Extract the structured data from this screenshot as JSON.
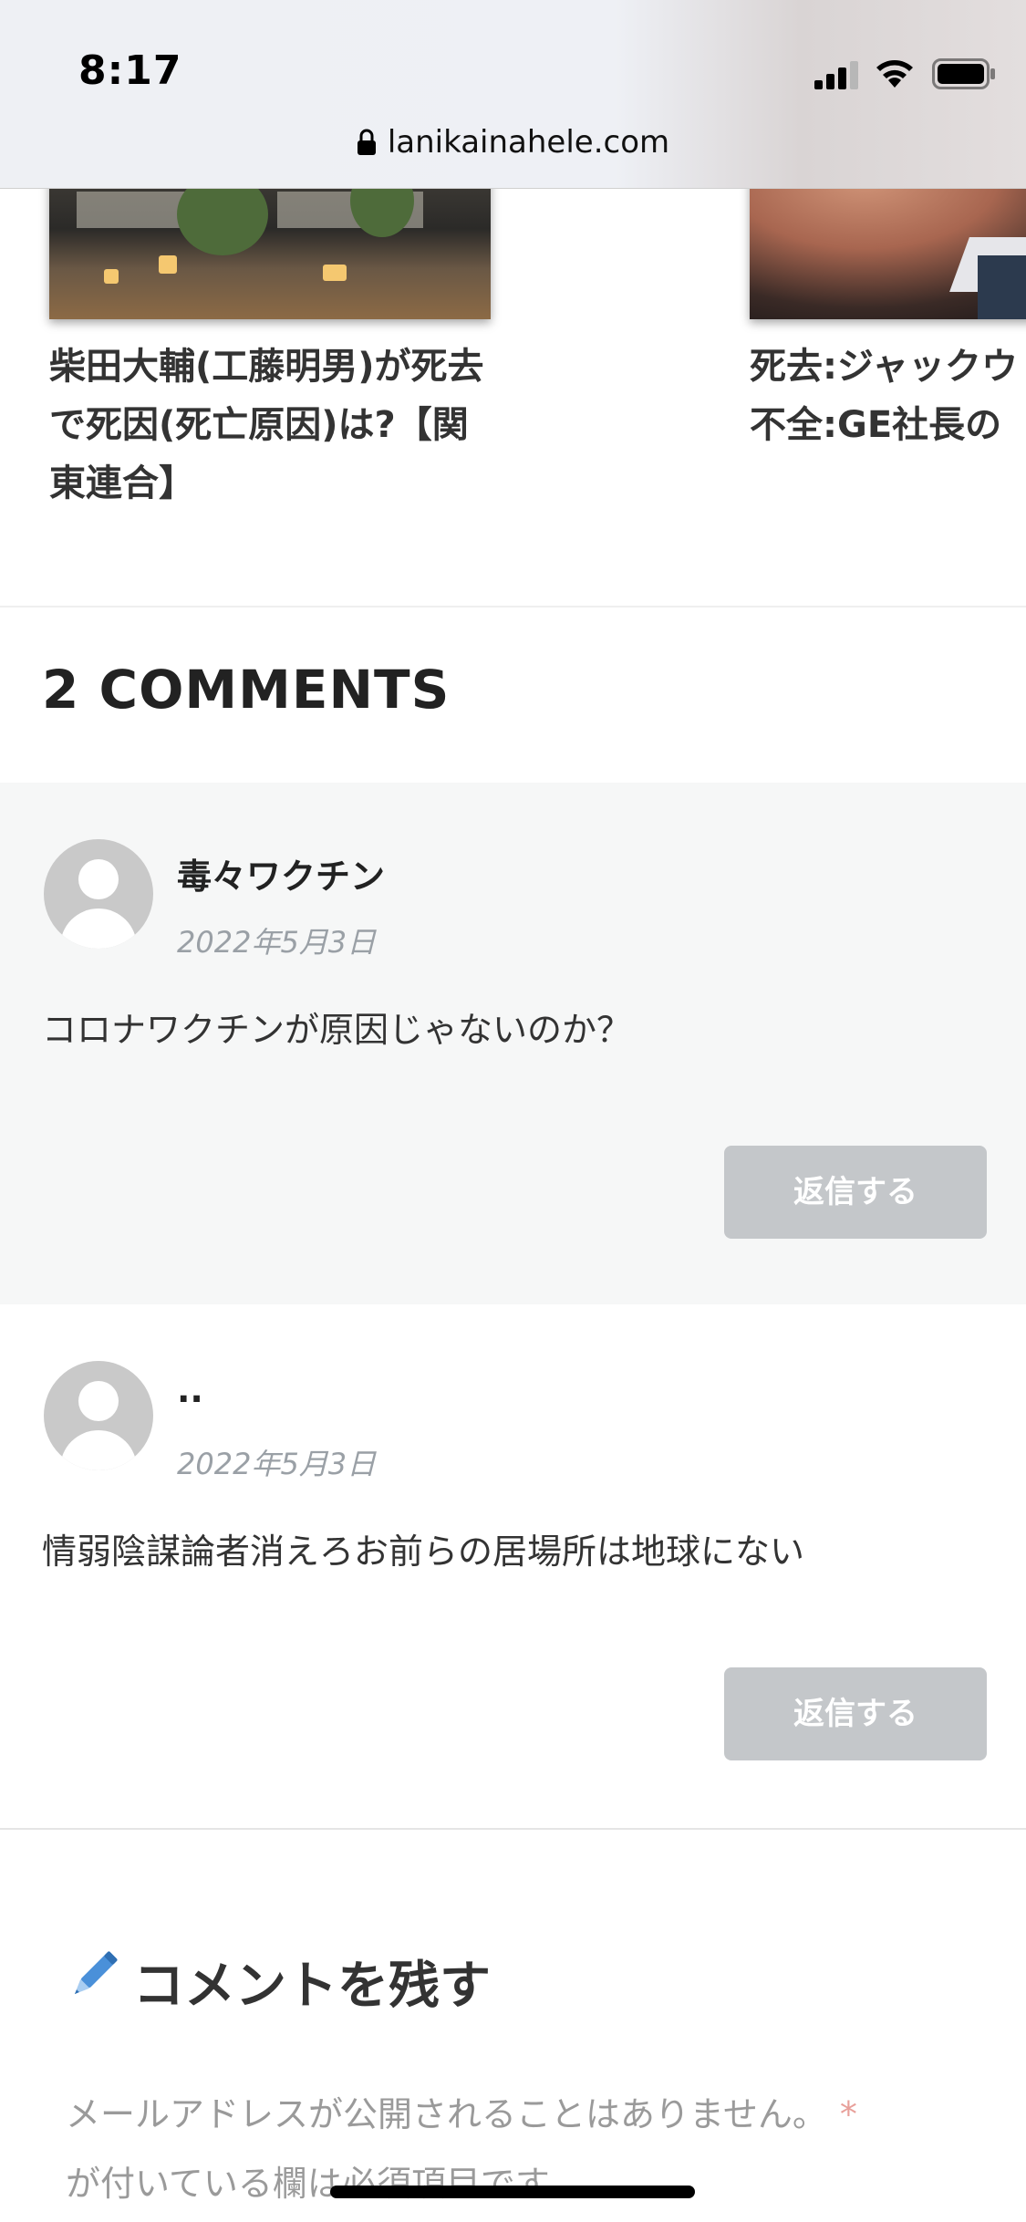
{
  "status_bar": {
    "time": "8:17",
    "url": "lanikainahele.com"
  },
  "related_posts": [
    {
      "title": "柴田大輔(工藤明男)が死去で死因(死亡原因)は?【関東連合】"
    },
    {
      "title_line1": "死去:ジャックウ",
      "title_line2": "不全:GE社長の"
    }
  ],
  "comments_section": {
    "heading": "2 COMMENTS",
    "comments": [
      {
        "author": "毒々ワクチン",
        "date": "2022年5月3日",
        "text": "コロナワクチンが原因じゃないのか？",
        "reply_label": "返信する"
      },
      {
        "author": "..",
        "date": "2022年5月3日",
        "text": "情弱陰謀論者消えろお前らの居場所は地球にない",
        "reply_label": "返信する"
      }
    ]
  },
  "leave_comment": {
    "title": "コメントを残す",
    "note_part1": "メールアドレスが公開されることはありません。",
    "required_mark": "*",
    "note_part2": "が付いている欄は必須項目です"
  },
  "icons": [
    "signal-icon",
    "wifi-icon",
    "battery-icon",
    "lock-icon",
    "pencil-icon",
    "avatar-icon"
  ],
  "colors": {
    "reply_button": "#c4c7ca",
    "date_text": "#9aa0a6",
    "required_mark": "#e8a09a",
    "pencil": "#4a90d9"
  }
}
